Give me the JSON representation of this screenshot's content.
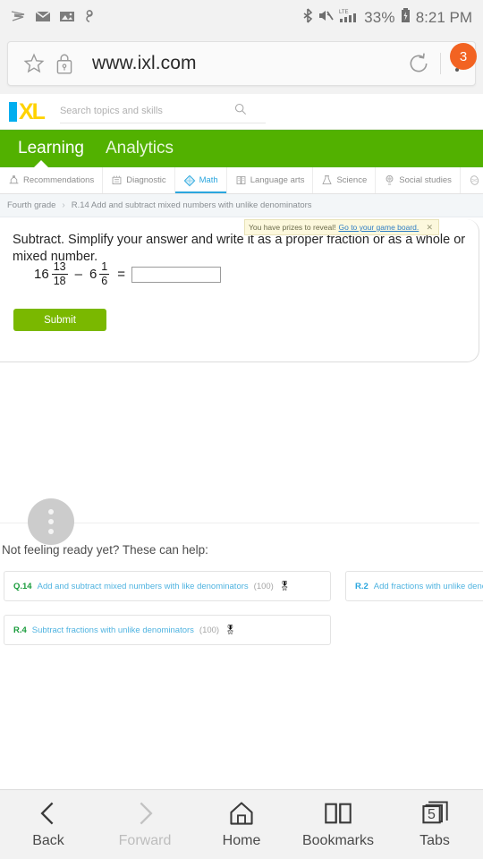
{
  "status_bar": {
    "icons_left": [
      "sprint-icon",
      "email-icon",
      "gallery-icon",
      "link-icon"
    ],
    "icons_right": [
      "bluetooth-icon",
      "mute-icon",
      "signal-lte-icon",
      "battery-icon"
    ],
    "network_label": "LTE",
    "battery_percent": "33%",
    "time": "8:21 PM"
  },
  "browser": {
    "url": "www.ixl.com",
    "star_icon": "bookmark-star-icon",
    "lock_icon": "lock-icon",
    "reload_icon": "reload-icon",
    "menu_icon": "overflow-menu-icon",
    "notification_count": "3",
    "notification_color": "#f26322"
  },
  "ixl_header": {
    "logo_i": "I",
    "logo_xl": "XL",
    "logo_blue": "#00aeef",
    "logo_yellow": "#ffd200",
    "search_placeholder": "Search topics and skills",
    "search_value": "",
    "search_icon": "search-icon"
  },
  "green_nav": {
    "accent": "#52b100",
    "items": [
      {
        "label": "Learning",
        "active": true
      },
      {
        "label": "Analytics",
        "active": false
      }
    ]
  },
  "subject_tabs": {
    "active_color": "#2ba6de",
    "items": [
      {
        "label": "Recommendations",
        "icon": "recommendations-icon",
        "active": false
      },
      {
        "label": "Diagnostic",
        "icon": "diagnostic-icon",
        "active": false
      },
      {
        "label": "Math",
        "icon": "math-icon",
        "active": true
      },
      {
        "label": "Language arts",
        "icon": "book-icon",
        "active": false
      },
      {
        "label": "Science",
        "icon": "flask-icon",
        "active": false
      },
      {
        "label": "Social studies",
        "icon": "globe-icon",
        "active": false
      },
      {
        "label": "",
        "icon": "spanish-icon",
        "active": false
      }
    ]
  },
  "breadcrumb": {
    "grade": "Fourth grade",
    "separator": "›",
    "skill": "R.14 Add and subtract mixed numbers with unlike denominators"
  },
  "prize_banner": {
    "text": "You have prizes to reveal!",
    "link": "Go to your game board.",
    "close_icon": "close-icon"
  },
  "question": {
    "prompt": "Subtract. Simplify your answer and write it as a proper fraction or as a whole or mixed number.",
    "term1_whole": "16",
    "term1_num": "13",
    "term1_den": "18",
    "operator": "–",
    "term2_whole": "6",
    "term2_num": "1",
    "term2_den": "6",
    "equals": "=",
    "answer_value": "",
    "answer_placeholder": "",
    "submit_label": "Submit"
  },
  "help_section": {
    "more_icon": "more-options-icon",
    "title": "Not feeling ready yet? These can help:",
    "cards": [
      {
        "code": "Q.14",
        "name": "Add and subtract mixed numbers with like denominators",
        "score": "(100)",
        "medal": "🎖"
      },
      {
        "code": "R.2",
        "name": "Add fractions with unlike deno",
        "score": "",
        "medal": ""
      },
      {
        "code": "R.4",
        "name": "Subtract fractions with unlike denominators",
        "score": "(100)",
        "medal": "🎖"
      }
    ]
  },
  "bottom_nav": [
    {
      "label": "Back",
      "icon": "chevron-left-icon",
      "disabled": false
    },
    {
      "label": "Forward",
      "icon": "chevron-right-icon",
      "disabled": true
    },
    {
      "label": "Home",
      "icon": "home-icon",
      "disabled": false
    },
    {
      "label": "Bookmarks",
      "icon": "bookmarks-icon",
      "disabled": false
    },
    {
      "label": "Tabs",
      "icon": "tabs-icon",
      "disabled": false,
      "count": "5"
    }
  ]
}
